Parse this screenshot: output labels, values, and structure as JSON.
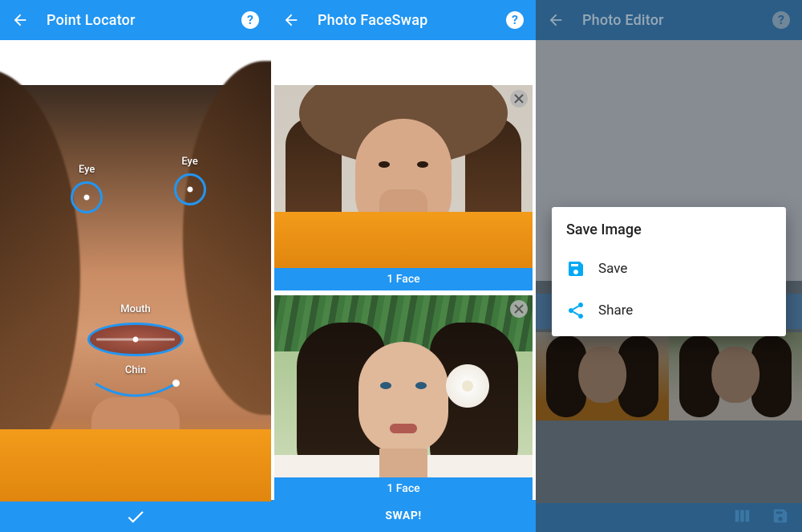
{
  "colors": {
    "primary": "#2196F3",
    "primary_dim": "#2b5d87",
    "accent_icon": "#03A9F4"
  },
  "screen_a": {
    "title": "Point Locator",
    "markers": {
      "eye_left": "Eye",
      "eye_right": "Eye",
      "mouth": "Mouth",
      "chin": "Chin"
    }
  },
  "screen_b": {
    "title": "Photo FaceSwap",
    "face_count_label": "1 Face",
    "swap_button": "SWAP!"
  },
  "screen_c": {
    "title": "Photo Editor",
    "dialog": {
      "title": "Save Image",
      "save": "Save",
      "share": "Share"
    }
  }
}
